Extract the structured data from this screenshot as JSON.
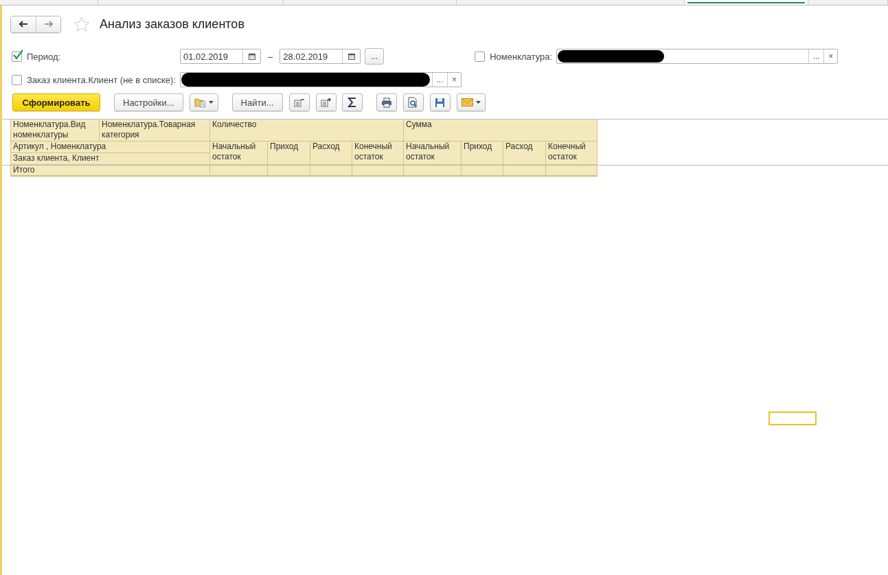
{
  "top_tabs": [
    {
      "selected": false
    },
    {
      "selected": false
    },
    {
      "selected": false
    },
    {
      "selected": false
    },
    {
      "selected": true
    },
    {
      "selected": false
    }
  ],
  "nav": {
    "back_disabled": false,
    "forward_disabled": true
  },
  "favorite": false,
  "title": "Анализ заказов клиентов",
  "period": {
    "label": "Период:",
    "checked": true,
    "from": "01.02.2019",
    "to": "28.02.2019",
    "separator": "–",
    "more": "..."
  },
  "nomenclature": {
    "label": "Номенклатура:",
    "checked": false,
    "more": "...",
    "clear": "×"
  },
  "client": {
    "label": "Заказ клиента.Клиент (не в списке):",
    "checked": false,
    "more": "...",
    "clear": "×"
  },
  "toolbar": [
    {
      "kind": "primary",
      "label": "Сформировать"
    },
    {
      "kind": "text",
      "label": "Настройки..."
    },
    {
      "kind": "variants"
    },
    {
      "kind": "text",
      "label": "Найти..."
    },
    {
      "kind": "collapse"
    },
    {
      "kind": "expand"
    },
    {
      "kind": "sum"
    },
    {
      "kind": "print"
    },
    {
      "kind": "preview"
    },
    {
      "kind": "save"
    },
    {
      "kind": "mail"
    }
  ],
  "report": {
    "row_headers": [
      "Номенклатура.Вид номенклатуры",
      "Номенклатура.Товарная категория",
      "Артикул , Номенклатура",
      "Заказ клиента, Клиент"
    ],
    "groups": [
      {
        "title": "Количество",
        "columns": [
          "Начальный остаток",
          "Приход",
          "Расход",
          "Конечный остаток"
        ]
      },
      {
        "title": "Сумма",
        "columns": [
          "Начальный остаток",
          "Приход",
          "Расход",
          "Конечный остаток"
        ]
      }
    ],
    "total_label": "Итого"
  }
}
